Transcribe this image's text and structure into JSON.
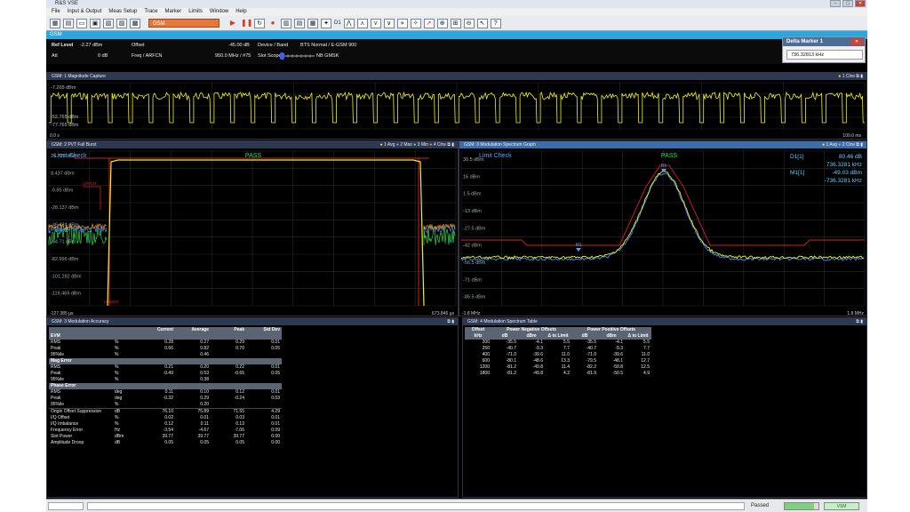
{
  "app": {
    "title": "R&S VSE"
  },
  "menu": [
    "File",
    "Input & Output",
    "Meas Setup",
    "Trace",
    "Marker",
    "Limits",
    "Window",
    "Help"
  ],
  "toolbar": {
    "measurement_select": "GSM",
    "run_mode": "D1"
  },
  "channel_tab": {
    "label": "GSM"
  },
  "settings": {
    "ref_level_label": "Ref Level",
    "ref_level_value": "-2.27 dBm",
    "offset_label": "Offset",
    "offset_value": "-45.00 dB",
    "att_label": "Att",
    "att_value": "0 dB",
    "freq_label": "Freq / ARFCN",
    "freq_value": "950.0 MHz / #75",
    "device_label": "Device / Band",
    "device_value": "BTS Normal / E-GSM 900",
    "slot_label": "Slot Scope",
    "slot_value": "NB GMSK"
  },
  "delta_marker": {
    "title": "Delta Marker 1",
    "value": "736.32813 kHz"
  },
  "colors": {
    "trace_yellow": "#f2f21a",
    "trace_blue": "#3f8dff",
    "trace_green": "#2fd84a",
    "trace_orange": "#f39b2d",
    "limit_red": "#d42020",
    "pass_green": "#25e04a",
    "marker_blue": "#4aa7ff"
  },
  "panel1": {
    "title": "GSM: 1 Magnitude Capture",
    "trace_label": "1 Clrw",
    "y_labels": [
      "-7.265 dBm",
      "-52.765 dBm",
      "-77.765 dBm"
    ],
    "x_start": "0.0 s",
    "x_end": "100.0 ms"
  },
  "panel2": {
    "title": "GSM: 2 PVT Full Burst",
    "traces_label": {
      "t1": "1 Avg",
      "t2": "2 Max",
      "t3": "3 Min",
      "t4": "4 Clrw"
    },
    "limit_check": "Limit Check",
    "pass": "PASS",
    "y_labels": [
      "26.723 dBm",
      "8.437 dBm",
      "-9.85 dBm",
      "-28.137 dBm",
      "-46.424 dBm",
      "-64.71 dBm",
      "-82.996 dBm",
      "-101.282 dBm",
      "-119.469 dBm"
    ],
    "x_start": "-127.385 µs",
    "x_end": "673.846 µs",
    "limit_text": [
      "UPPER",
      "LOWER"
    ]
  },
  "panel3": {
    "title": "GSM: 3 Modulation Spectrum Graph",
    "traces_label": {
      "t1": "1 Avg",
      "t2": "2 Clrw"
    },
    "limit_check": "Limit Check",
    "pass": "PASS",
    "y_labels": [
      "30.5 dBm",
      "16 dBm",
      "1.5 dBm",
      "-13 dBm",
      "-27.5 dBm",
      "-42 dBm",
      "-56.5 dBm",
      "-71 dBm",
      "-85.5 dBm"
    ],
    "x_start": "-1.8 MHz",
    "x_end": "1.8 MHz",
    "marker_d1_label": "D1[1]",
    "marker_d1_value": "80.46 dB",
    "marker_d1_freq": "736.3281 kHz",
    "marker_m1_label": "M1[1]",
    "marker_m1_value": "-49.03 dBm",
    "marker_m1_freq": "-736.3281 kHz",
    "marker_tag_d1": "D1",
    "marker_tag_m1": "M1"
  },
  "panel4": {
    "title": "GSM: 3 Modulation Accuracy",
    "headers": [
      "",
      "",
      "Current",
      "Average",
      "Peak",
      "Std Dev"
    ],
    "groups": [
      {
        "name": "EVM",
        "rows": [
          [
            "RMS",
            "%",
            "0.28",
            "0.27",
            "0.29",
            "0.01"
          ],
          [
            "Peak",
            "%",
            "0.66",
            "0.82",
            "0.70",
            "0.05"
          ],
          [
            "95%ile",
            "%",
            "",
            "0.46",
            "",
            ""
          ]
        ]
      },
      {
        "name": "Mag Error",
        "rows": [
          [
            "RMS",
            "%",
            "0.21",
            "0.20",
            "0.22",
            "0.01"
          ],
          [
            "Peak",
            "%",
            "-0.49",
            "0.53",
            "-0.65",
            "0.05"
          ],
          [
            "95%ile",
            "%",
            "",
            "0.38",
            "",
            ""
          ]
        ]
      },
      {
        "name": "Phase Error",
        "rows": [
          [
            "RMS",
            "deg",
            "0.11",
            "0.10",
            "0.12",
            "0.01"
          ],
          [
            "Peak",
            "deg",
            "-0.32",
            "0.29",
            "-0.24",
            "0.03"
          ],
          [
            "95%ile",
            "%",
            "",
            "0.20",
            "",
            ""
          ]
        ]
      }
    ],
    "other_rows": [
      [
        "Origin Offset Suppression",
        "dB",
        "76.10",
        "75.89",
        "71.55",
        "4.29"
      ],
      [
        "I/Q Offset",
        "%",
        "0.02",
        "0.01",
        "0.03",
        "0.01"
      ],
      [
        "I/Q Imbalance",
        "%",
        "0.12",
        "0.11",
        "0.13",
        "0.01"
      ],
      [
        "Frequency Error",
        "Hz",
        "-3.54",
        "-4.67",
        "-7.06",
        "0.09"
      ],
      [
        "Slot Power",
        "dBm",
        "39.77",
        "39.77",
        "39.77",
        "0.00"
      ],
      [
        "Amplitude Droop",
        "dB",
        "0.05",
        "0.05",
        "0.05",
        "0.00"
      ]
    ]
  },
  "panel5": {
    "title": "GSM: 4 Modulation Spectrum Table",
    "group_headers": [
      "Offset",
      "Power Negative Offsets",
      "Power Positive Offsets"
    ],
    "headers": [
      "kHz",
      "dB",
      "dBm",
      "Δ to Limit",
      "dB",
      "dBm",
      "Δ to Limit"
    ],
    "rows": [
      [
        "200",
        "-35.5",
        "-4.1",
        "5.5",
        "-35.5",
        "-4.1",
        "5.5"
      ],
      [
        "250",
        "-40.7",
        "-9.3",
        "7.7",
        "-40.7",
        "-9.3",
        "7.7"
      ],
      [
        "400",
        "-71.0",
        "-39.6",
        "11.0",
        "-71.0",
        "-39.6",
        "11.0"
      ],
      [
        "600",
        "-80.1",
        "-48.6",
        "13.3",
        "-79.5",
        "-48.1",
        "12.7"
      ],
      [
        "1200",
        "-81.2",
        "-49.8",
        "11.4",
        "-82.2",
        "-50.8",
        "12.5"
      ],
      [
        "1800",
        "-81.2",
        "-49.8",
        "4.2",
        "-81.9",
        "-50.5",
        "4.9"
      ]
    ]
  },
  "status": {
    "message": "Passed",
    "app_indicator": "VSM",
    "progress": 0.88
  }
}
